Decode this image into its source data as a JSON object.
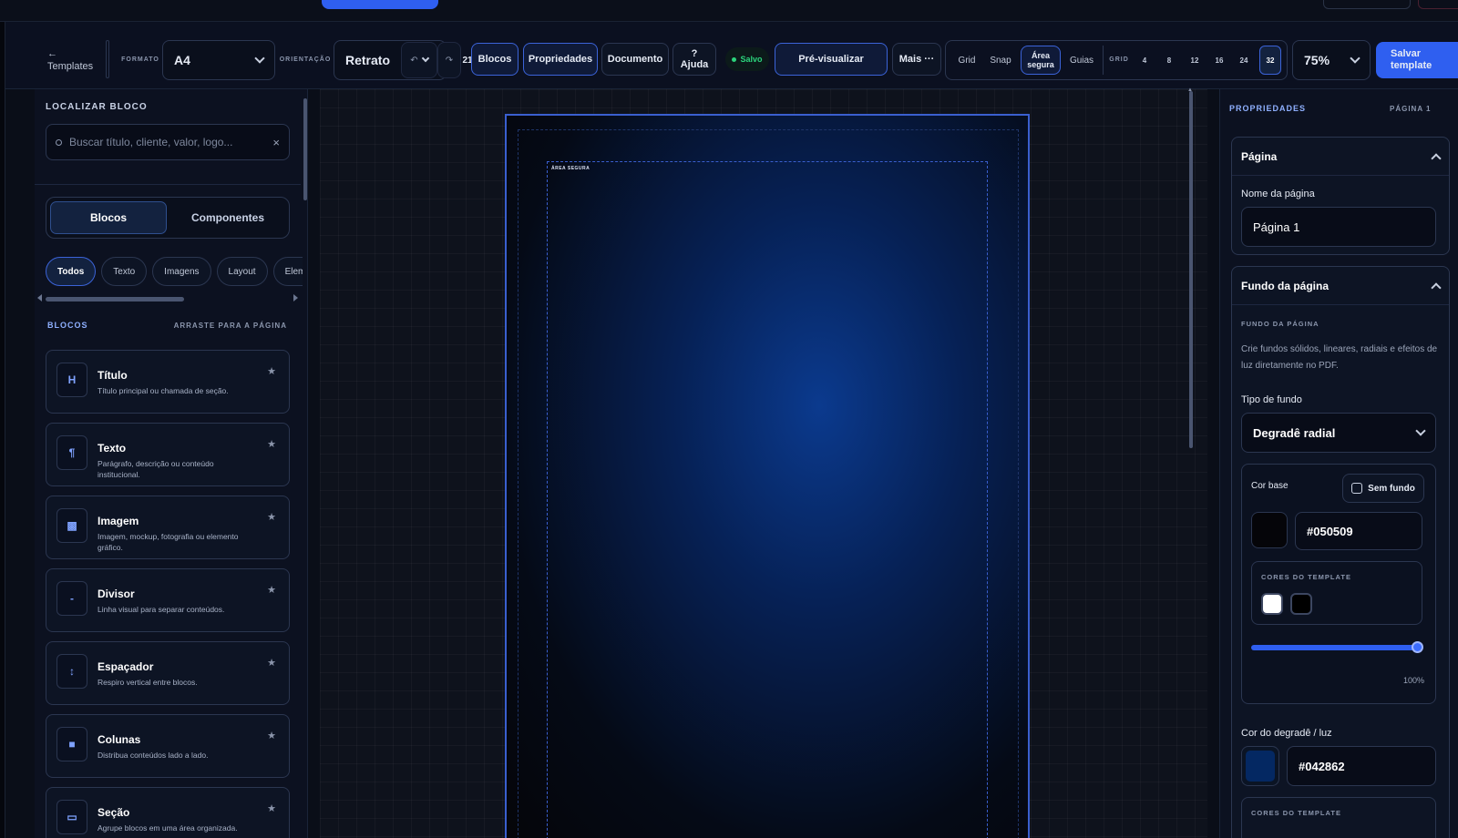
{
  "toolbar": {
    "back_arrow": "←",
    "back_label": "Templates",
    "format_label": "FORMATO",
    "format_value": "A4",
    "orientation_label": "ORIENTAÇÃO",
    "orientation_value": "Retrato",
    "undo_glyph": "↶",
    "redo_glyph": "↷",
    "history_count": "21",
    "blocos": "Blocos",
    "propriedades": "Propriedades",
    "documento": "Documento",
    "ajuda_q": "?",
    "ajuda": "Ajuda",
    "saved": "Salvo",
    "preview": "Pré-visualizar",
    "more": "Mais ···",
    "grid": "Grid",
    "snap": "Snap",
    "area_segura_1": "Área",
    "area_segura_2": "segura",
    "guias": "Guias",
    "grid_label": "GRID",
    "grid_sizes": [
      "4",
      "8",
      "12",
      "16",
      "24",
      "32"
    ],
    "zoom": "75%",
    "save_1": "Salvar",
    "save_2": "template"
  },
  "left": {
    "find_title": "LOCALIZAR BLOCO",
    "search_placeholder": "Buscar título, cliente, valor, logo...",
    "clear_glyph": "×",
    "tabs": [
      "Blocos",
      "Componentes"
    ],
    "chips": [
      "Todos",
      "Texto",
      "Imagens",
      "Layout",
      "Element"
    ],
    "section_title": "BLOCOS",
    "section_hint": "ARRASTE PARA A PÁGINA",
    "cards": [
      {
        "icon": "H",
        "title": "Título",
        "desc": "Título principal ou chamada de seção."
      },
      {
        "icon": "¶",
        "title": "Texto",
        "desc": "Parágrafo, descrição ou conteúdo institucional."
      },
      {
        "icon": "▩",
        "title": "Imagem",
        "desc": "Imagem, mockup, fotografia ou elemento gráfico."
      },
      {
        "icon": "-",
        "title": "Divisor",
        "desc": "Linha visual para separar conteúdos."
      },
      {
        "icon": "↕",
        "title": "Espaçador",
        "desc": "Respiro vertical entre blocos."
      },
      {
        "icon": "■",
        "title": "Colunas",
        "desc": "Distribua conteúdos lado a lado."
      },
      {
        "icon": "▭",
        "title": "Seção",
        "desc": "Agrupe blocos em uma área organizada."
      }
    ],
    "star": "★"
  },
  "canvas": {
    "safe_area_label": "ÁREA SEGURA"
  },
  "right": {
    "title": "PROPRIEDADES",
    "page_indicator": "PÁGINA 1",
    "page_section": "Página",
    "page_name_label": "Nome da página",
    "page_name_value": "Página 1",
    "bg_section": "Fundo da página",
    "bg_caption": "FUNDO DA PÁGINA",
    "bg_help": "Crie fundos sólidos, lineares, radiais e efeitos de luz diretamente no PDF.",
    "bg_type_label": "Tipo de fundo",
    "bg_type_value": "Degradê radial",
    "base_color_label": "Cor base",
    "no_bg_label": "Sem fundo",
    "base_color_value": "#050509",
    "template_colors_label": "CORES DO TEMPLATE",
    "opacity_value": "100%",
    "gradient_color_label": "Cor do degradê / luz",
    "gradient_color_value": "#042862",
    "template_colors_label_2": "CORES DO TEMPLATE"
  },
  "colors": {
    "accent": "#2f5ff0",
    "base_color": "#050509",
    "gradient_color": "#042862",
    "template_white": "#ffffff",
    "template_black": "#000000",
    "saved_dot": "#2bd37c"
  },
  "slider": {
    "opacity": 1.0
  }
}
